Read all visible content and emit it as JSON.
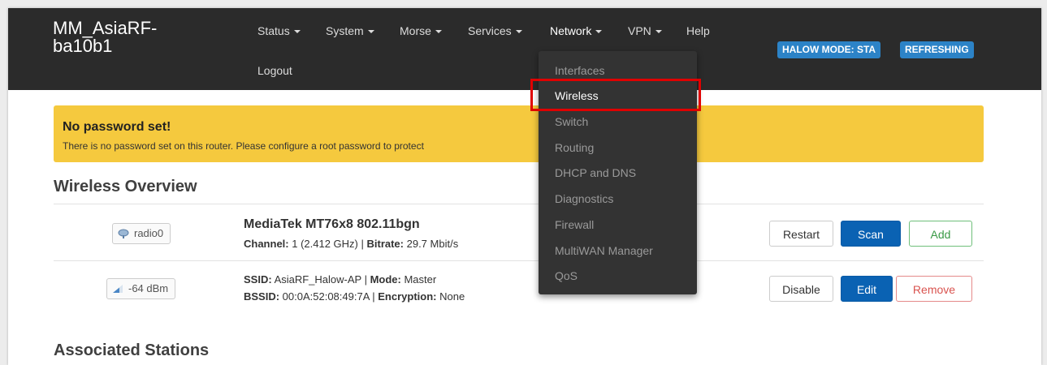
{
  "brand": {
    "line1": "MM_AsiaRF-",
    "line2": "ba10b1"
  },
  "nav": {
    "status": "Status",
    "system": "System",
    "morse": "Morse",
    "services": "Services",
    "network": "Network",
    "vpn": "VPN",
    "help": "Help",
    "logout": "Logout"
  },
  "badges": {
    "halow_mode": "HALOW MODE: STA",
    "refreshing": "REFRESHING"
  },
  "network_dropdown": {
    "items": [
      "Interfaces",
      "Wireless",
      "Switch",
      "Routing",
      "DHCP and DNS",
      "Diagnostics",
      "Firewall",
      "MultiWAN Manager",
      "QoS"
    ],
    "selected": "Wireless"
  },
  "alert": {
    "title": "No password set!",
    "text": "There is no password set on this router. Please configure a root password to protect"
  },
  "wireless_overview": {
    "heading": "Wireless Overview",
    "device": {
      "radio_label": "radio0",
      "name": "MediaTek MT76x8 802.11bgn",
      "channel_label": "Channel:",
      "channel_value": " 1 (2.412 GHz) | ",
      "bitrate_label": "Bitrate:",
      "bitrate_value": " 29.7 Mbit/s",
      "buttons": {
        "restart": "Restart",
        "scan": "Scan",
        "add": "Add"
      }
    },
    "network": {
      "signal_label": "-64 dBm",
      "ssid_label": "SSID:",
      "ssid_value": " AsiaRF_Halow-AP | ",
      "mode_label": "Mode:",
      "mode_value": " Master",
      "bssid_label": "BSSID:",
      "bssid_value": " 00:0A:52:08:49:7A | ",
      "encryption_label": "Encryption:",
      "encryption_value": " None",
      "buttons": {
        "disable": "Disable",
        "edit": "Edit",
        "remove": "Remove"
      }
    }
  },
  "associated_stations": {
    "heading": "Associated Stations"
  },
  "colors": {
    "navbar": "#2b2b2b",
    "accent": "#0a62b3",
    "badge": "#2c83c7",
    "alert": "#f5c93e",
    "highlight": "#e00000"
  }
}
